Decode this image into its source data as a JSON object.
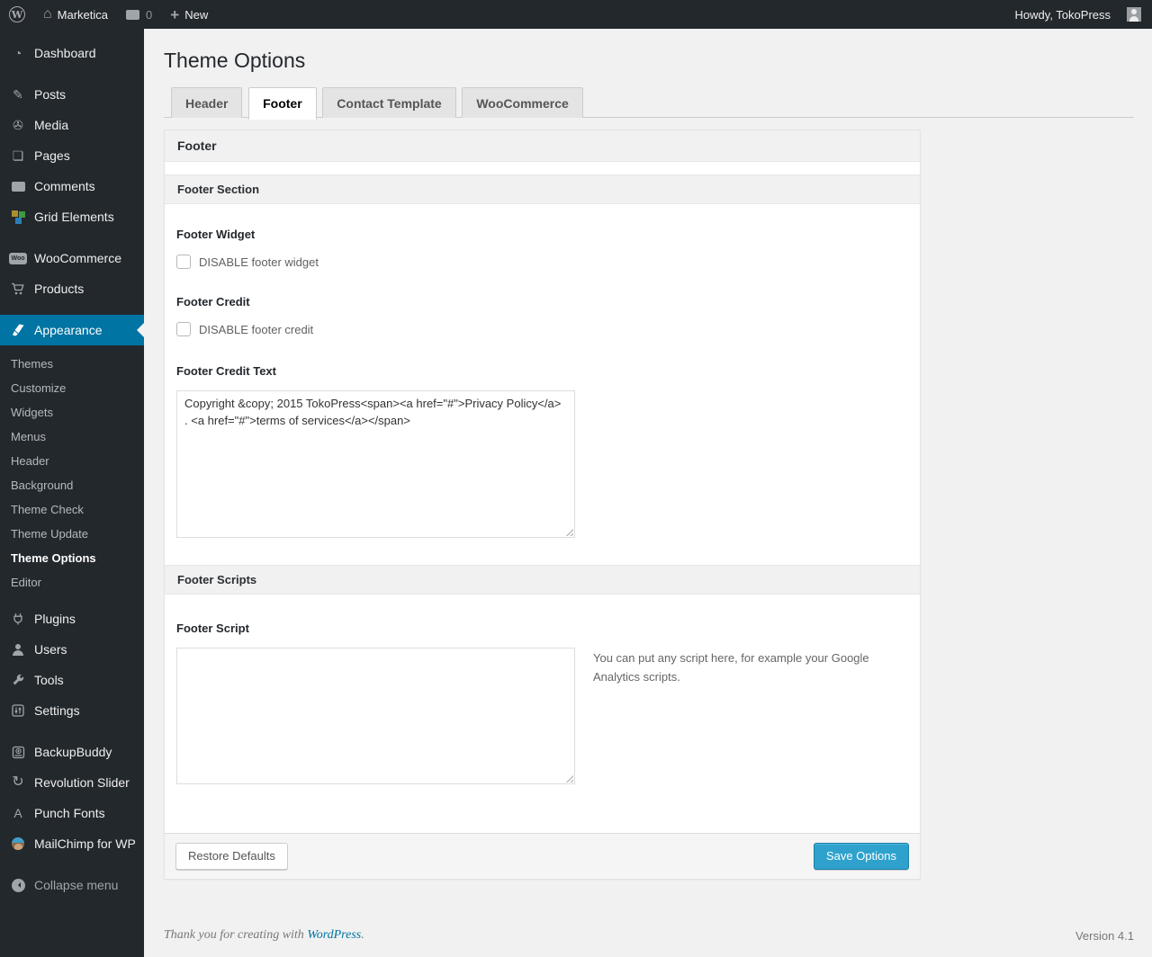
{
  "admin_bar": {
    "site_name": "Marketica",
    "comment_count": "0",
    "new_label": "New",
    "howdy": "Howdy, TokoPress"
  },
  "sidebar": {
    "items": [
      {
        "label": "Dashboard"
      },
      {
        "label": "Posts"
      },
      {
        "label": "Media"
      },
      {
        "label": "Pages"
      },
      {
        "label": "Comments"
      },
      {
        "label": "Grid Elements"
      },
      {
        "label": "WooCommerce"
      },
      {
        "label": "Products"
      },
      {
        "label": "Appearance"
      },
      {
        "label": "Plugins"
      },
      {
        "label": "Users"
      },
      {
        "label": "Tools"
      },
      {
        "label": "Settings"
      },
      {
        "label": "BackupBuddy"
      },
      {
        "label": "Revolution Slider"
      },
      {
        "label": "Punch Fonts"
      },
      {
        "label": "MailChimp for WP"
      },
      {
        "label": "Collapse menu"
      }
    ],
    "appearance_submenu": [
      {
        "label": "Themes"
      },
      {
        "label": "Customize"
      },
      {
        "label": "Widgets"
      },
      {
        "label": "Menus"
      },
      {
        "label": "Header"
      },
      {
        "label": "Background"
      },
      {
        "label": "Theme Check"
      },
      {
        "label": "Theme Update"
      },
      {
        "label": "Theme Options"
      },
      {
        "label": "Editor"
      }
    ]
  },
  "page": {
    "title": "Theme Options",
    "tabs": [
      {
        "label": "Header"
      },
      {
        "label": "Footer"
      },
      {
        "label": "Contact Template"
      },
      {
        "label": "WooCommerce"
      }
    ],
    "panel": {
      "header_title": "Footer",
      "footer_section": {
        "title": "Footer Section",
        "footer_widget_label": "Footer Widget",
        "footer_widget_checkbox": "DISABLE footer widget",
        "footer_credit_label": "Footer Credit",
        "footer_credit_checkbox": "DISABLE footer credit",
        "footer_credit_text_label": "Footer Credit Text",
        "footer_credit_text_value": "Copyright &copy; 2015 TokoPress<span><a href=\"#\">Privacy Policy</a> . <a href=\"#\">terms of services</a></span>"
      },
      "footer_scripts": {
        "title": "Footer Scripts",
        "footer_script_label": "Footer Script",
        "footer_script_value": "",
        "help_text": "You can put any script here, for example your Google Analytics scripts."
      },
      "buttons": {
        "restore": "Restore Defaults",
        "save": "Save Options"
      }
    }
  },
  "site_footer": {
    "thanks_prefix": "Thank you for creating with ",
    "wordpress_link": "WordPress",
    "thanks_suffix": ".",
    "version": "Version 4.1"
  },
  "colors": {
    "accent": "#0074a2",
    "primary_button": "#2ea2cc",
    "admin_bar_bg": "#23282d",
    "page_bg": "#f1f1f1"
  }
}
